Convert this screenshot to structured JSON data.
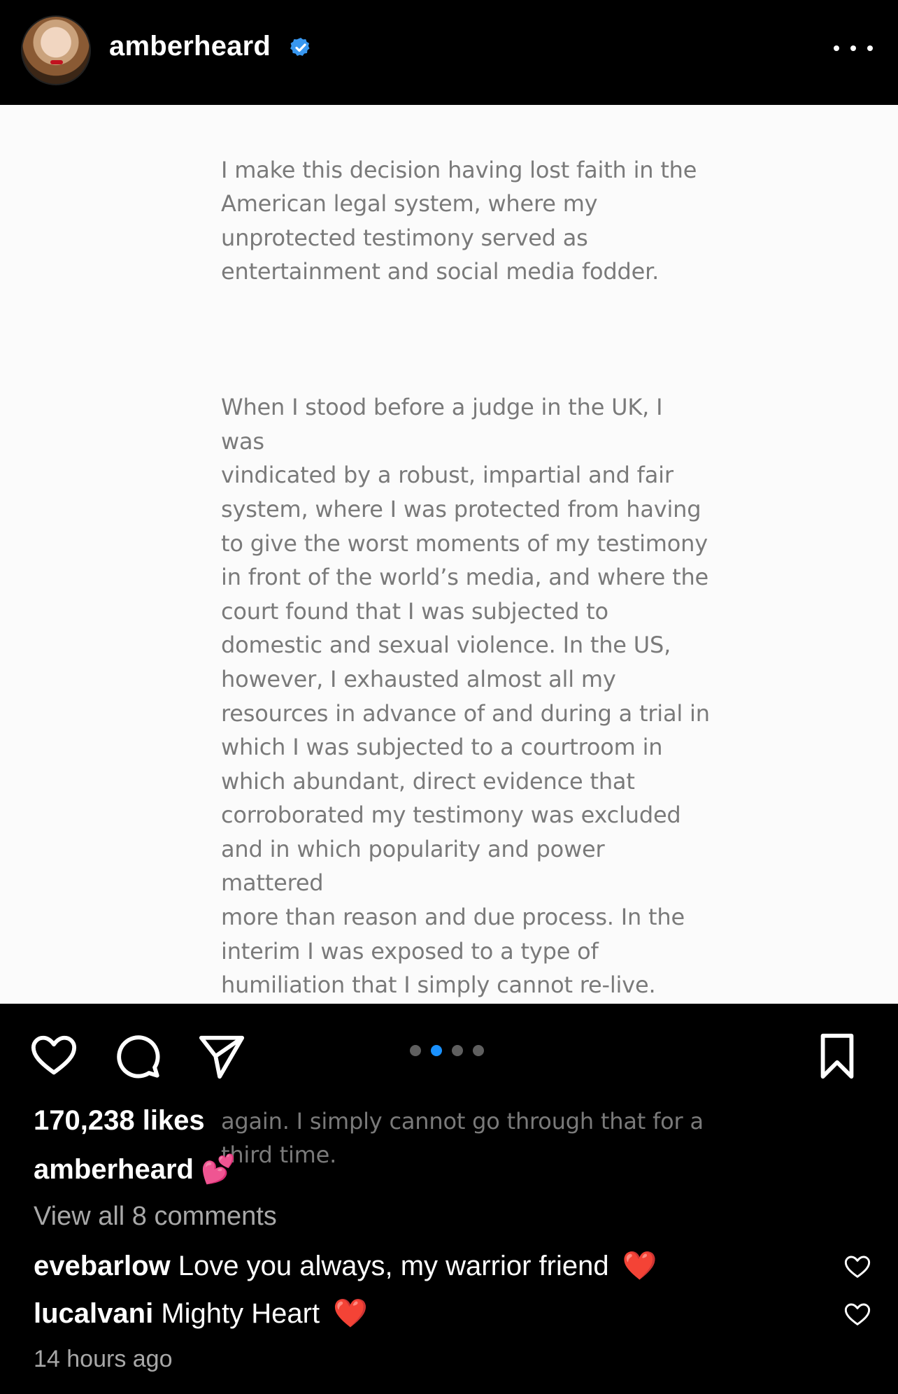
{
  "header": {
    "username": "amberheard",
    "verified_icon": "verified-badge-icon",
    "more_icon": "more-options-icon"
  },
  "post": {
    "paragraphs": [
      "I make this decision having lost faith in the\nAmerican legal system, where my\nunprotected testimony served as\nentertainment and social media fodder.",
      "When I stood before a judge in the UK, I was\nvindicated by a robust, impartial and fair\nsystem, where I was protected from having\nto give the worst moments of my testimony\nin front of the world’s media, and where the\ncourt found that I was subjected to\ndomestic and sexual violence. In the US,\nhowever, I exhausted almost all my\nresources in advance of and during a trial in\nwhich I was subjected to a courtroom in\nwhich abundant, direct evidence that\ncorroborated my testimony was excluded\nand in which popularity and power mattered\nmore than reason and due process. In the\ninterim I was exposed to a type of\nhumiliation that I simply cannot re-live.\nEven if my US appeal is successful, the best\noutcome would be a re-trial where a new\njury would have to consider the evidence\nagain. I simply cannot go through that for a\nthird time."
    ],
    "carousel": {
      "count": 4,
      "active_index": 1
    }
  },
  "actions": {
    "like_icon": "heart-icon",
    "comment_icon": "comment-icon",
    "share_icon": "send-icon",
    "save_icon": "bookmark-icon"
  },
  "likes": "170,238 likes",
  "caption": {
    "username": "amberheard",
    "emoji": "💕"
  },
  "view_all": "View all 8 comments",
  "comments": [
    {
      "user": "evebarlow",
      "text": "Love you always, my warrior friend",
      "emoji": "❤️"
    },
    {
      "user": "lucalvani",
      "text": "Mighty Heart",
      "emoji": "❤️"
    }
  ],
  "time": "14 hours ago",
  "colors": {
    "background": "#000000",
    "accent_blue": "#1a91ff",
    "secondary_text": "#a8a8a8"
  }
}
